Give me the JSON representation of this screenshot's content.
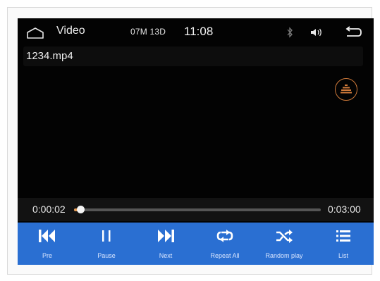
{
  "status_bar": {
    "app_title": "Video",
    "date": "07M 13D",
    "time": "11:08",
    "icons": [
      "home-icon",
      "bluetooth-icon",
      "volume-icon",
      "back-arrow-icon"
    ]
  },
  "file": {
    "name": "1234.mp4"
  },
  "playback": {
    "elapsed": "0:00:02",
    "duration": "0:03:00",
    "progress_fraction": 0.011
  },
  "controls": [
    {
      "label": "Pre",
      "icon": "skip-previous-icon"
    },
    {
      "label": "Pause",
      "icon": "pause-icon"
    },
    {
      "label": "Next",
      "icon": "skip-next-icon"
    },
    {
      "label": "Repeat All",
      "icon": "repeat-icon"
    },
    {
      "label": "Random play",
      "icon": "shuffle-icon"
    },
    {
      "label": "List",
      "icon": "list-icon"
    }
  ],
  "colors": {
    "screen_bg": "#030303",
    "control_bar": "#2a6fd2",
    "accent": "#e39b55",
    "eq_ring": "#d07a3a"
  }
}
